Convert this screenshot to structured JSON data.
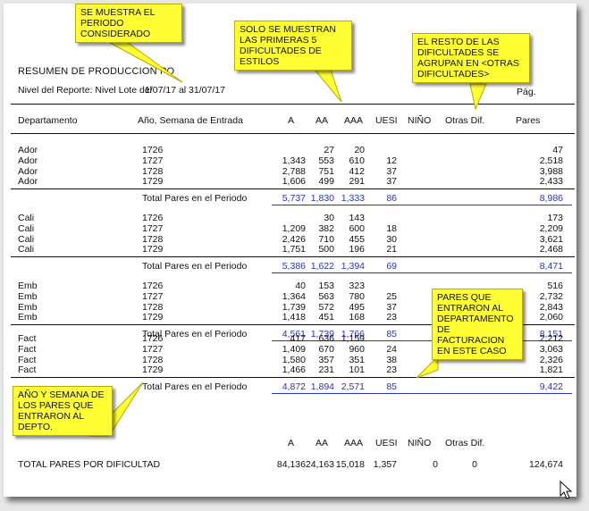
{
  "report": {
    "title": "RESUMEN DE PRODUCCION PO",
    "level_label": "Nivel del Reporte: Nivel Lote del",
    "period": "1/07/17 al 31/07/17",
    "page_label": "Pág."
  },
  "headers": {
    "dept": "Departamento",
    "week": "Año, Semana de Entrada",
    "a": "A",
    "aa": "AA",
    "aaa": "AAA",
    "uesi": "UESI",
    "nino": "NIÑO",
    "otras": "Otras Dif.",
    "pares": "Pares"
  },
  "subtotal_label": "Total Pares en el Periodo",
  "departments": [
    {
      "rows": [
        {
          "dept": "Ador",
          "week": "1726",
          "a": "",
          "aa": "27",
          "aaa": "20",
          "uesi": "",
          "pares": "47"
        },
        {
          "dept": "Ador",
          "week": "1727",
          "a": "1,343",
          "aa": "553",
          "aaa": "610",
          "uesi": "12",
          "pares": "2,518"
        },
        {
          "dept": "Ador",
          "week": "1728",
          "a": "2,788",
          "aa": "751",
          "aaa": "412",
          "uesi": "37",
          "pares": "3,988"
        },
        {
          "dept": "Ador",
          "week": "1729",
          "a": "1,606",
          "aa": "499",
          "aaa": "291",
          "uesi": "37",
          "pares": "2,433"
        }
      ],
      "total": {
        "a": "5,737",
        "aa": "1,830",
        "aaa": "1,333",
        "uesi": "86",
        "pares": "8,986"
      }
    },
    {
      "rows": [
        {
          "dept": "Cali",
          "week": "1726",
          "a": "",
          "aa": "30",
          "aaa": "143",
          "uesi": "",
          "pares": "173"
        },
        {
          "dept": "Cali",
          "week": "1727",
          "a": "1,209",
          "aa": "382",
          "aaa": "600",
          "uesi": "18",
          "pares": "2,209"
        },
        {
          "dept": "Cali",
          "week": "1728",
          "a": "2,426",
          "aa": "710",
          "aaa": "455",
          "uesi": "30",
          "pares": "3,621"
        },
        {
          "dept": "Cali",
          "week": "1729",
          "a": "1,751",
          "aa": "500",
          "aaa": "196",
          "uesi": "21",
          "pares": "2,468"
        }
      ],
      "total": {
        "a": "5,386",
        "aa": "1,622",
        "aaa": "1,394",
        "uesi": "69",
        "pares": "8,471"
      }
    },
    {
      "rows": [
        {
          "dept": "Emb",
          "week": "1726",
          "a": "40",
          "aa": "153",
          "aaa": "323",
          "uesi": "",
          "pares": "516"
        },
        {
          "dept": "Emb",
          "week": "1727",
          "a": "1,364",
          "aa": "563",
          "aaa": "780",
          "uesi": "25",
          "pares": "2,732"
        },
        {
          "dept": "Emb",
          "week": "1728",
          "a": "1,739",
          "aa": "572",
          "aaa": "495",
          "uesi": "37",
          "pares": "2,843"
        },
        {
          "dept": "Emb",
          "week": "1729",
          "a": "1,418",
          "aa": "451",
          "aaa": "168",
          "uesi": "23",
          "pares": "2,060"
        }
      ],
      "total": {
        "a": "4,561",
        "aa": "1,739",
        "aaa": "1,766",
        "uesi": "85",
        "pares": "8,151"
      }
    },
    {
      "rows": [
        {
          "dept": "Fact",
          "week": "1726",
          "a": "417",
          "aa": "636",
          "aaa": "1,159",
          "uesi": "",
          "pares": "2,212"
        },
        {
          "dept": "Fact",
          "week": "1727",
          "a": "1,409",
          "aa": "670",
          "aaa": "960",
          "uesi": "24",
          "pares": "3,063"
        },
        {
          "dept": "Fact",
          "week": "1728",
          "a": "1,580",
          "aa": "357",
          "aaa": "351",
          "uesi": "38",
          "pares": "2,326"
        },
        {
          "dept": "Fact",
          "week": "1729",
          "a": "1,466",
          "aa": "231",
          "aaa": "101",
          "uesi": "23",
          "pares": "1,821"
        }
      ],
      "total": {
        "a": "4,872",
        "aa": "1,894",
        "aaa": "2,571",
        "uesi": "85",
        "pares": "9,422"
      }
    }
  ],
  "grand": {
    "label": "TOTAL PARES POR DIFICULTAD",
    "a": "84,136",
    "aa": "24,163",
    "aaa": "15,018",
    "uesi": "1,357",
    "nino": "0",
    "otras": "0",
    "pares": "124,674"
  },
  "callouts": {
    "period": "SE MUESTRA EL\nPERIODO\nCONSIDERADO",
    "first5": "SOLO SE MUESTRAN\nLAS PRIMERAS 5\nDIFICULTADES DE\nESTILOS",
    "rest": "EL RESTO DE LAS\nDIFICULTADES SE\nAGRUPAN EN <OTRAS\nDIFICULTADES>",
    "fact": "PARES QUE\nENTRARON AL\nDEPARTAMENTO\nDE\nFACTURACION\nEN ESTE CASO",
    "week": "AÑO Y SEMANA DE\nLOS PARES QUE\nENTRARON AL\nDEPTO."
  },
  "colors": {
    "callout_bg": "#ffff33",
    "total_blue": "#2233cc"
  }
}
